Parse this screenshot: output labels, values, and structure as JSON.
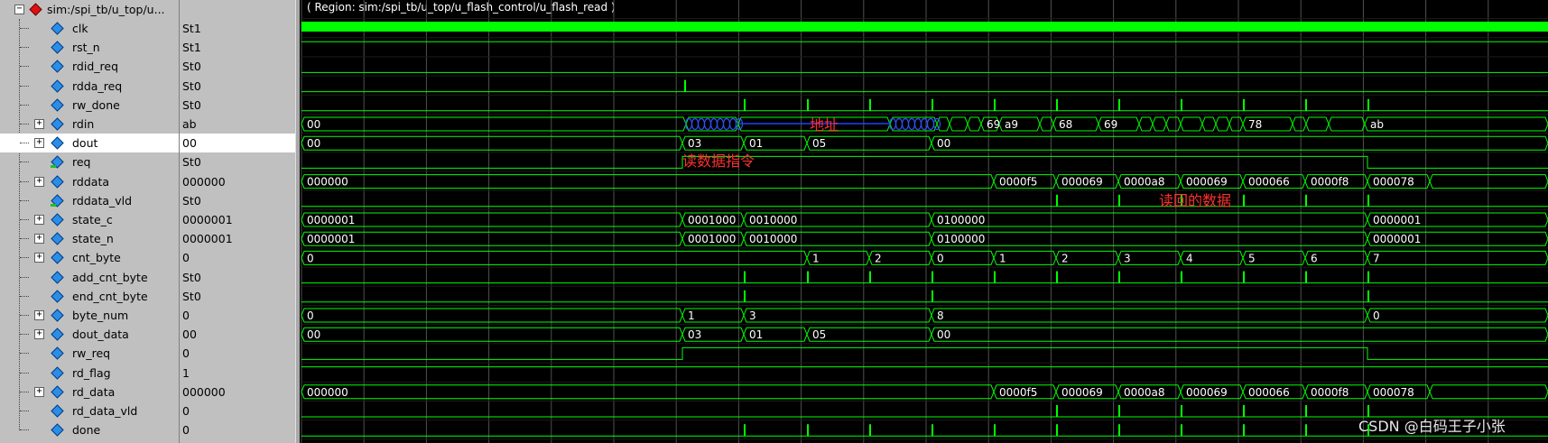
{
  "root": {
    "label": "sim:/spi_tb/u_top/u..."
  },
  "region": "( Region: sim:/spi_tb/u_top/u_flash_control/u_flash_read )",
  "signals": [
    {
      "name": "clk",
      "value": "St1",
      "bus": false
    },
    {
      "name": "rst_n",
      "value": "St1",
      "bus": false
    },
    {
      "name": "rdid_req",
      "value": "St0",
      "bus": false
    },
    {
      "name": "rdda_req",
      "value": "St0",
      "bus": false
    },
    {
      "name": "rw_done",
      "value": "St0",
      "bus": false
    },
    {
      "name": "rdin",
      "value": "ab",
      "bus": true
    },
    {
      "name": "dout",
      "value": "00",
      "bus": true
    },
    {
      "name": "req",
      "value": "St0",
      "bus": false
    },
    {
      "name": "rddata",
      "value": "000000",
      "bus": true
    },
    {
      "name": "rddata_vld",
      "value": "St0",
      "bus": false
    },
    {
      "name": "state_c",
      "value": "0000001",
      "bus": true
    },
    {
      "name": "state_n",
      "value": "0000001",
      "bus": true
    },
    {
      "name": "cnt_byte",
      "value": "0",
      "bus": true
    },
    {
      "name": "add_cnt_byte",
      "value": "St0",
      "bus": false
    },
    {
      "name": "end_cnt_byte",
      "value": "St0",
      "bus": false
    },
    {
      "name": "byte_num",
      "value": "0",
      "bus": true
    },
    {
      "name": "dout_data",
      "value": "00",
      "bus": true
    },
    {
      "name": "rw_req",
      "value": "0",
      "bus": false
    },
    {
      "name": "rd_flag",
      "value": "1",
      "bus": false
    },
    {
      "name": "rd_data",
      "value": "000000",
      "bus": true
    },
    {
      "name": "rd_data_vld",
      "value": "0",
      "bus": false
    },
    {
      "name": "done",
      "value": "0",
      "bus": false
    }
  ],
  "bus_values": {
    "rdin": [
      "00",
      "69",
      "a9",
      "68",
      "69",
      "78",
      "ab"
    ],
    "dout": [
      "00",
      "03",
      "01",
      "05",
      "00"
    ],
    "rddata": [
      "000000",
      "0000f5",
      "000069",
      "0000a8",
      "000069",
      "000066",
      "0000f8",
      "000078",
      "000000"
    ],
    "state_c": [
      "0000001",
      "0001000",
      "0010000",
      "0100000",
      "0000001"
    ],
    "state_n": [
      "0000001",
      "0001000",
      "0010000",
      "0100000",
      "0000001"
    ],
    "cnt_byte": [
      "0",
      "1",
      "2",
      "0",
      "1",
      "2",
      "3",
      "4",
      "5",
      "6",
      "7",
      "0"
    ],
    "byte_num": [
      "0",
      "1",
      "3",
      "8",
      "0"
    ],
    "dout_data": [
      "00",
      "03",
      "01",
      "05",
      "00"
    ],
    "rd_data": [
      "000000",
      "0000f5",
      "000069",
      "0000a8",
      "000069",
      "000066",
      "0000f8",
      "000078",
      "000000"
    ]
  },
  "annotations": {
    "address": "地址",
    "read_cmd": "读数据指令",
    "read_back": "读回的数据"
  },
  "watermark": "CSDN @白码王子小张",
  "colors": {
    "wave": "#00ff00",
    "bus_fill": "#0000d0",
    "grid": "#505050",
    "annotation": "#ff3030",
    "panel": "#c0c0c0",
    "selected_row": "#ffffff"
  }
}
